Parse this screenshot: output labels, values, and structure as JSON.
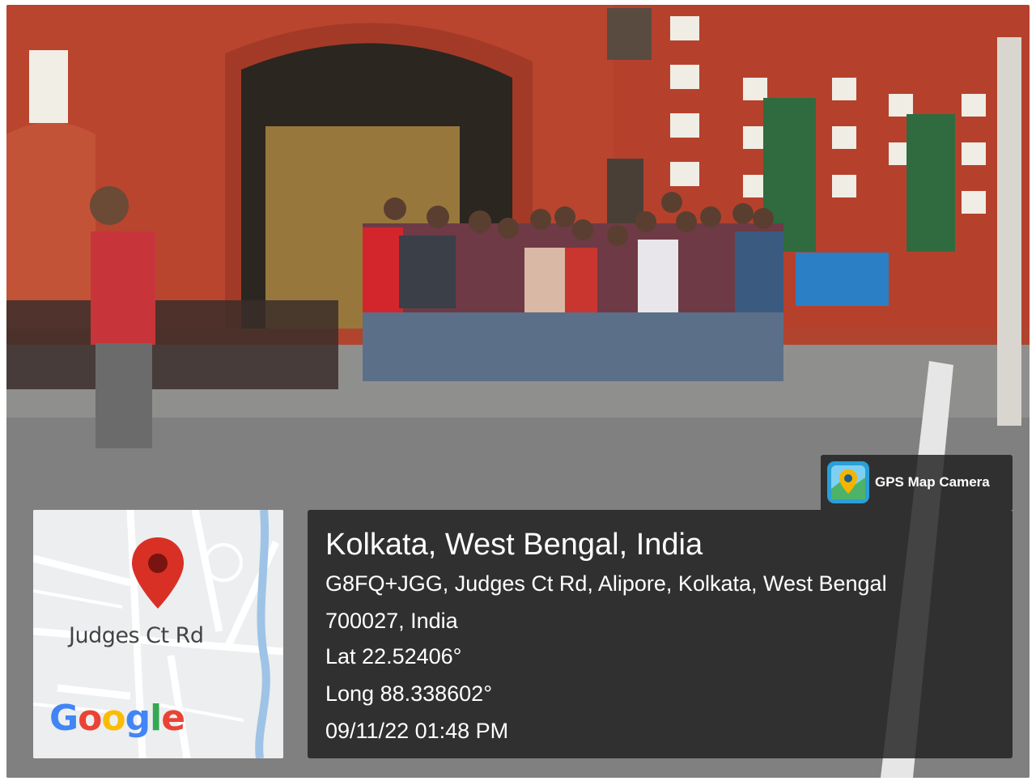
{
  "overlay": {
    "badge": {
      "app_name": "GPS Map Camera",
      "icon": "gps-map-camera-icon"
    },
    "map": {
      "road_label": "Judges Ct Rd",
      "brand": [
        "G",
        "o",
        "o",
        "g",
        "l",
        "e"
      ],
      "brand_colors": [
        "#4285F4",
        "#EA4335",
        "#FBBC05",
        "#4285F4",
        "#34A853",
        "#EA4335"
      ],
      "pin_icon": "map-pin-icon",
      "pin_color": "#d93025"
    },
    "location": {
      "title": "Kolkata, West Bengal, India",
      "address_line_1": "G8FQ+JGG, Judges Ct Rd, Alipore, Kolkata, West Bengal",
      "address_line_2": "700027, India",
      "latitude": "Lat 22.52406°",
      "longitude": "Long 88.338602°",
      "datetime": "09/11/22 01:48 PM"
    }
  }
}
